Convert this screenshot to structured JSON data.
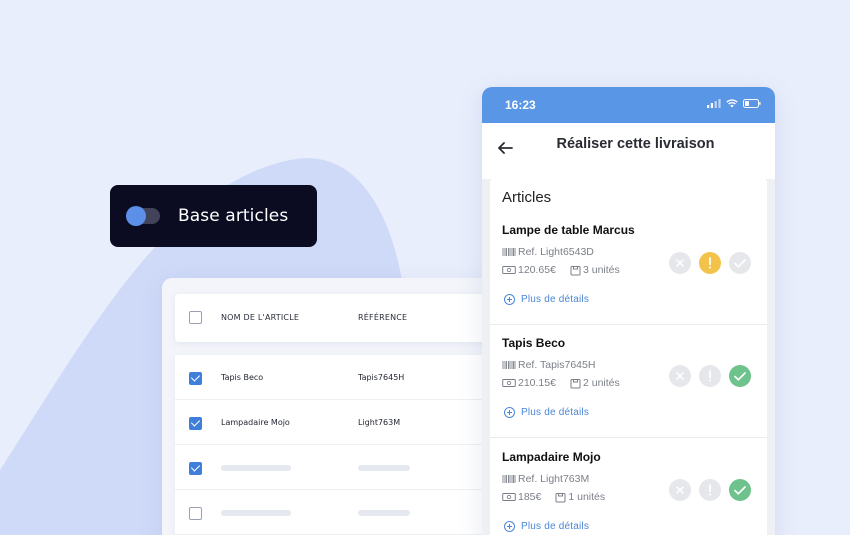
{
  "toggle": {
    "label": "Base articles",
    "enabled": true
  },
  "table": {
    "headers": [
      "NOM DE L'ARTICLE",
      "RÉFÉRENCE"
    ],
    "rows": [
      {
        "checked": true,
        "name": "Tapis Beco",
        "ref": "Tapis7645H"
      },
      {
        "checked": true,
        "name": "Lampadaire Mojo",
        "ref": "Light763M"
      },
      {
        "checked": true,
        "name": "",
        "ref": ""
      },
      {
        "checked": false,
        "name": "",
        "ref": ""
      }
    ]
  },
  "phone": {
    "time": "16:23",
    "title": "Réaliser cette livraison",
    "section": "Articles",
    "more_label": "Plus de détails",
    "items": [
      {
        "name": "Lampe de table Marcus",
        "ref": "Ref. Light6543D",
        "price": "120.65€",
        "qty": "3 unités",
        "status": "warning"
      },
      {
        "name": "Tapis Beco",
        "ref": "Ref. Tapis7645H",
        "price": "210.15€",
        "qty": "2 unités",
        "status": "ok"
      },
      {
        "name": "Lampadaire Mojo",
        "ref": "Ref. Light763M",
        "price": "185€",
        "qty": "1 unités",
        "status": "ok"
      }
    ]
  },
  "colors": {
    "accent": "#5a96e6",
    "warning": "#f2c24a",
    "ok": "#6dc38b",
    "dark": "#0b0c22"
  }
}
